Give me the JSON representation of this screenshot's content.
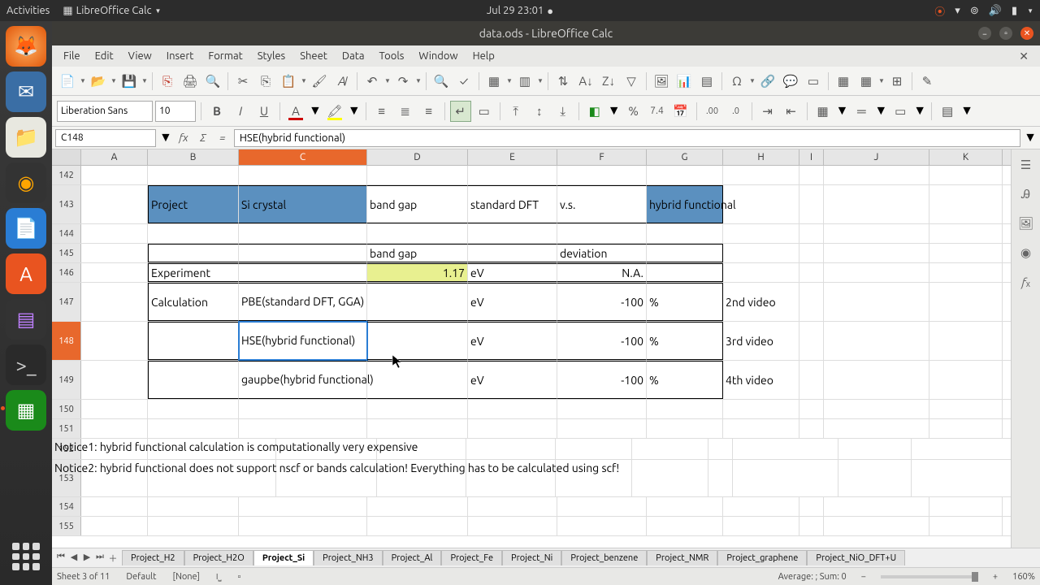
{
  "sysbar": {
    "activities": "Activities",
    "app": "LibreOffice Calc",
    "datetime": "Jul 29  23:01"
  },
  "window": {
    "title": "data.ods - LibreOffice Calc"
  },
  "menu": {
    "file": "File",
    "edit": "Edit",
    "view": "View",
    "insert": "Insert",
    "format": "Format",
    "styles": "Styles",
    "sheet": "Sheet",
    "data": "Data",
    "tools": "Tools",
    "window": "Window",
    "help": "Help"
  },
  "fmt": {
    "fontname": "Liberation Sans",
    "fontsize": "10",
    "bold": "B",
    "italic": "I",
    "underline": "U",
    "fontcolor_glyph": "A",
    "num_pct": "%",
    "num_fmt": "7.4",
    "curr": "$"
  },
  "formula": {
    "cellref": "C148",
    "fx": "fx",
    "sigma": "Σ",
    "eq": "=",
    "content": "HSE(hybrid functional)"
  },
  "columns": [
    "A",
    "B",
    "C",
    "D",
    "E",
    "F",
    "G",
    "H",
    "I",
    "J",
    "K"
  ],
  "selected_col": "C",
  "selected_row": "148",
  "rows": {
    "142": {},
    "143": {
      "B": "Project",
      "C": "Si crystal",
      "D": "band gap",
      "E": "standard DFT",
      "F": "v.s.",
      "G": "hybrid functional"
    },
    "144": {},
    "145": {
      "D": "band gap",
      "F": "deviation"
    },
    "146": {
      "B": "Experiment",
      "D": "1.17",
      "E": "eV",
      "F": "N.A."
    },
    "147": {
      "B": "Calculation",
      "C": "PBE(standard DFT, GGA)",
      "E": "eV",
      "F": "-100",
      "G": "%",
      "H": "2nd video"
    },
    "148": {
      "C": "HSE(hybrid functional)",
      "E": "eV",
      "F": "-100",
      "G": "%",
      "H": "3rd video"
    },
    "149": {
      "C": "gaupbe(hybrid functional)",
      "E": "eV",
      "F": "-100",
      "G": "%",
      "H": "4th video"
    },
    "150": {},
    "151": {},
    "152": {
      "B": "Notice1: hybrid functional calculation is computationally very expensive"
    },
    "153": {
      "B": "Notice2: hybrid functional does not support nscf or bands calculation! Everything has to be calculated using scf!"
    },
    "154": {},
    "155": {}
  },
  "row_heights": {
    "143": 48,
    "147": 48,
    "148": 48,
    "149": 48,
    "152": 26,
    "153": 46
  },
  "tabs": [
    "Project_H2",
    "Project_H2O",
    "Project_Si",
    "Project_NH3",
    "Project_Al",
    "Project_Fe",
    "Project_Ni",
    "Project_benzene",
    "Project_NMR",
    "Project_graphene",
    "Project_NiO_DFT+U"
  ],
  "active_tab": "Project_Si",
  "status": {
    "sheet": "Sheet 3 of 11",
    "style": "Default",
    "lang": "[None]",
    "summary": "Average: ; Sum: 0",
    "zoom": "160%"
  }
}
